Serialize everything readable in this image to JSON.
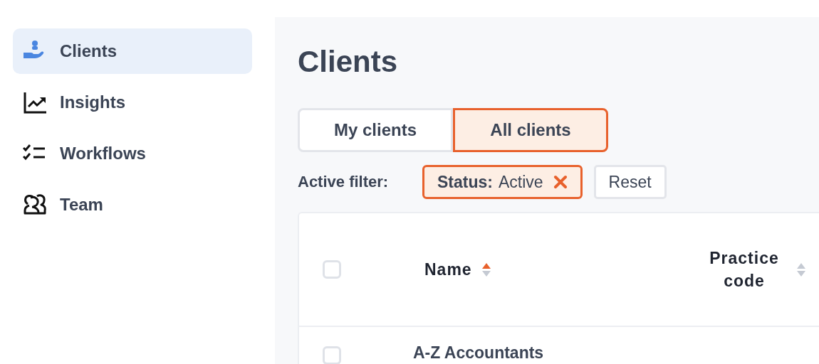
{
  "sidebar": {
    "items": [
      {
        "label": "Clients",
        "selected": true
      },
      {
        "label": "Insights",
        "selected": false
      },
      {
        "label": "Workflows",
        "selected": false
      },
      {
        "label": "Team",
        "selected": false
      }
    ]
  },
  "page_title": "Clients",
  "tabs": [
    {
      "label": "My clients",
      "selected": false
    },
    {
      "label": "All clients",
      "selected": true
    }
  ],
  "filters": {
    "label": "Active filter:",
    "chips": [
      {
        "key": "Status:",
        "value": "Active"
      }
    ],
    "reset": "Reset"
  },
  "table": {
    "select_all_checked": false,
    "columns": [
      {
        "label": "Name",
        "sorted": true
      },
      {
        "label": "Practice code",
        "sorted": false
      }
    ],
    "rows": [
      {
        "checked": false,
        "cells": [
          "A-Z Accountants"
        ]
      }
    ]
  }
}
